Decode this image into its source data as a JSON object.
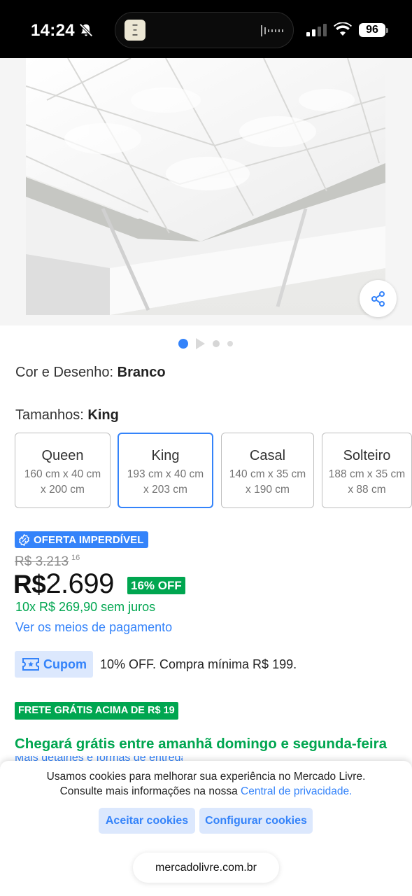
{
  "status_bar": {
    "time": "14:24",
    "battery": "96",
    "icons": [
      "bell-slash-icon",
      "waveform-icon",
      "signal-icon",
      "wifi-icon",
      "battery-icon"
    ]
  },
  "gallery": {
    "image": "white-mattress-topper-photo",
    "share_icon": "share-icon",
    "pages": 4,
    "current_page": 1
  },
  "variations": {
    "color_label": "Cor e Desenho:",
    "color_value": "Branco",
    "size_label": "Tamanhos:",
    "size_value": "King",
    "sizes": [
      {
        "name": "Queen",
        "dims": "160 cm x 40 cm x 200 cm",
        "selected": false
      },
      {
        "name": "King",
        "dims": "193 cm x 40 cm x 203 cm",
        "selected": true
      },
      {
        "name": "Casal",
        "dims": "140 cm x 35 cm x 190 cm",
        "selected": false
      },
      {
        "name": "Solteiro",
        "dims": "188 cm x 35 cm x 88 cm",
        "selected": false
      }
    ]
  },
  "pricing": {
    "offer_badge": "OFERTA IMPERDÍVEL",
    "old_price": "R$ 3.213",
    "old_cents": "16",
    "currency": "R$",
    "price": "2.699",
    "discount": "16% OFF",
    "installments": "10x R$ 269,90 sem juros",
    "payment_link": "Ver os meios de pagamento"
  },
  "coupon": {
    "label": "Cupom",
    "text": "10% OFF. Compra mínima R$ 199."
  },
  "shipping": {
    "badge": "FRETE GRÁTIS ACIMA DE R$ 19",
    "delivery": "Chegará grátis entre amanhã domingo e segunda-feira",
    "more_link": "Mais detalhes e formas de entrega"
  },
  "cookies": {
    "text_line1": "Usamos cookies para melhorar sua experiência no Mercado Livre.",
    "text_line2": "Consulte mais informações na nossa",
    "privacy_link": "Central de privacidade.",
    "accept": "Aceitar cookies",
    "configure": "Configurar cookies"
  },
  "browser": {
    "url": "mercadolivre.com.br"
  },
  "colors": {
    "accent": "#3483fa",
    "green": "#00a650",
    "light_blue": "#dce8fd"
  }
}
